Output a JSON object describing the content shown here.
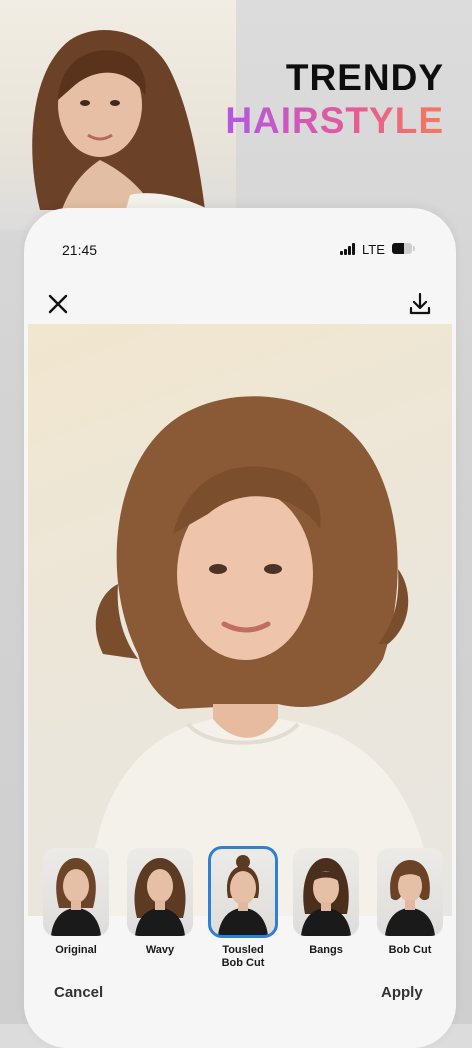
{
  "headline": {
    "line1": "TRENDY",
    "line2": "HAIRSTYLE"
  },
  "status_bar": {
    "time": "21:45",
    "network": "LTE",
    "battery_level": 0.6
  },
  "toolbar": {
    "close_icon": "close-icon",
    "download_icon": "download-icon"
  },
  "styles": [
    {
      "label": "Original",
      "selected": false
    },
    {
      "label": "Wavy",
      "selected": false
    },
    {
      "label": "Tousled Bob Cut",
      "selected": true
    },
    {
      "label": "Bangs",
      "selected": false
    },
    {
      "label": "Bob Cut",
      "selected": false
    }
  ],
  "actions": {
    "cancel": "Cancel",
    "apply": "Apply"
  },
  "colors": {
    "accent_gradient_start": "#b356e6",
    "accent_gradient_end": "#f47a5c",
    "selection": "#2f7fd4"
  }
}
